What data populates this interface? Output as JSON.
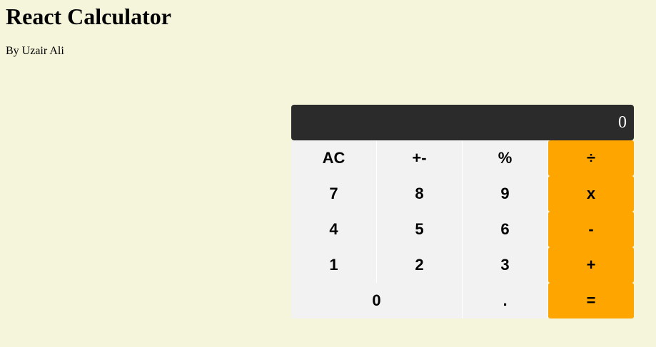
{
  "header": {
    "title": "React Calculator",
    "byline": "By Uzair Ali"
  },
  "calculator": {
    "display": "0",
    "keys": [
      {
        "label": "AC",
        "type": "function"
      },
      {
        "label": "+-",
        "type": "function"
      },
      {
        "label": "%",
        "type": "function"
      },
      {
        "label": "÷",
        "type": "operator"
      },
      {
        "label": "7",
        "type": "digit"
      },
      {
        "label": "8",
        "type": "digit"
      },
      {
        "label": "9",
        "type": "digit"
      },
      {
        "label": "x",
        "type": "operator"
      },
      {
        "label": "4",
        "type": "digit"
      },
      {
        "label": "5",
        "type": "digit"
      },
      {
        "label": "6",
        "type": "digit"
      },
      {
        "label": "-",
        "type": "operator"
      },
      {
        "label": "1",
        "type": "digit"
      },
      {
        "label": "2",
        "type": "digit"
      },
      {
        "label": "3",
        "type": "digit"
      },
      {
        "label": "+",
        "type": "operator"
      },
      {
        "label": "0",
        "type": "digit"
      },
      {
        "label": ".",
        "type": "digit"
      },
      {
        "label": "=",
        "type": "operator"
      }
    ]
  },
  "colors": {
    "background": "#f5f5dc",
    "display": "#2b2b2b",
    "key": "#f2f2f2",
    "operator": "#ffa500"
  }
}
